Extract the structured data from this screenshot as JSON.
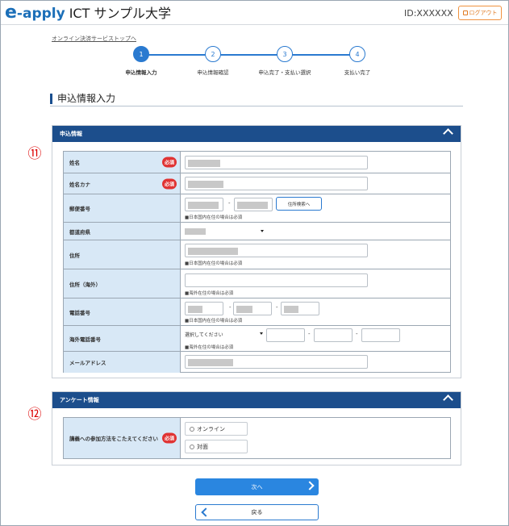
{
  "header": {
    "logo_e": "e",
    "logo_apply": "-apply",
    "university": "ICT サンプル大学",
    "user_id": "ID:XXXXXX",
    "logout_label": "ログアウト"
  },
  "breadcrumb": "オンライン決済サービストップへ",
  "steps": [
    {
      "num": "1",
      "label": "申込情報入力"
    },
    {
      "num": "2",
      "label": "申込情報確認"
    },
    {
      "num": "3",
      "label": "申込完了・支払い選択"
    },
    {
      "num": "4",
      "label": "支払い完了"
    }
  ],
  "section_title": "申込情報入力",
  "annotations": {
    "first": "⑪",
    "second": "⑫"
  },
  "applicant_panel": {
    "title": "申込情報",
    "required_badge": "必須",
    "rows": {
      "name": "姓名",
      "name_kana": "姓名カナ",
      "postal": "郵便番号",
      "prefecture": "都道府県",
      "address": "住所",
      "address_overseas": "住所（海外）",
      "phone": "電話番号",
      "overseas_phone": "海外電話番号",
      "email": "メールアドレス"
    },
    "address_search_button": "住所検索へ",
    "note_domestic": "■日本国内在住の場合は必須",
    "note_overseas": "■海外在住の場合は必須",
    "select_placeholder": "選択してください",
    "dash": "-"
  },
  "survey_panel": {
    "title": "アンケート情報",
    "question": "講義への参加方法をこたえてください",
    "options": [
      "オンライン",
      "対面"
    ]
  },
  "buttons": {
    "next": "次へ",
    "back": "戻る"
  }
}
